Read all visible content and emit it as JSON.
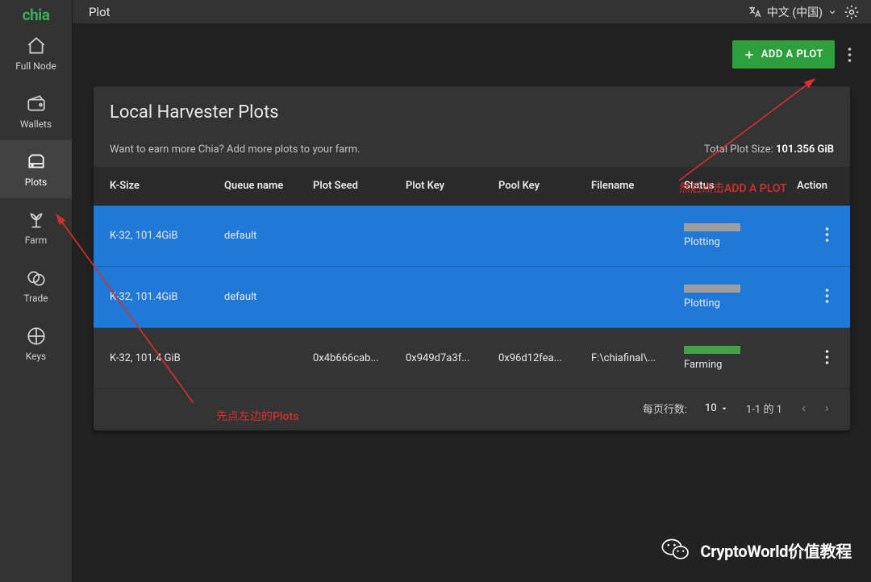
{
  "logo": "chia",
  "sidebar": {
    "items": [
      {
        "label": "Full Node"
      },
      {
        "label": "Wallets"
      },
      {
        "label": "Plots"
      },
      {
        "label": "Farm"
      },
      {
        "label": "Trade"
      },
      {
        "label": "Keys"
      }
    ]
  },
  "header": {
    "title": "Plot",
    "language": "中文 (中国)"
  },
  "actions": {
    "add_plot": "ADD A PLOT"
  },
  "card": {
    "title": "Local Harvester Plots",
    "hint": "Want to earn more Chia? Add more plots to your farm.",
    "total_label": "Total Plot Size: ",
    "total_value": "101.356 GiB"
  },
  "columns": {
    "ksize": "K-Size",
    "queue": "Queue name",
    "seed": "Plot Seed",
    "key": "Plot Key",
    "pool": "Pool Key",
    "file": "Filename",
    "status": "Status",
    "action": "Action"
  },
  "rows": [
    {
      "ksize": "K-32, 101.4GiB",
      "queue": "default",
      "seed": "",
      "key": "",
      "pool": "",
      "file": "",
      "status": "Plotting",
      "kind": "plotting"
    },
    {
      "ksize": "K-32, 101.4GiB",
      "queue": "default",
      "seed": "",
      "key": "",
      "pool": "",
      "file": "",
      "status": "Plotting",
      "kind": "plotting"
    },
    {
      "ksize": "K-32, 101.4 GiB",
      "queue": "",
      "seed": "0x4b666cab...",
      "key": "0x949d7a3f...",
      "pool": "0x96d12fea...",
      "file": "F:\\chiafinal\\...",
      "status": "Farming",
      "kind": "farming"
    }
  ],
  "pager": {
    "rows_label": "每页行数:",
    "rows_value": "10",
    "range": "1-1 的 1"
  },
  "annotations": {
    "plots_hint": "先点左边的Plots",
    "add_hint": "然后点击ADD A PLOT"
  },
  "watermark": "CryptoWorld价值教程"
}
